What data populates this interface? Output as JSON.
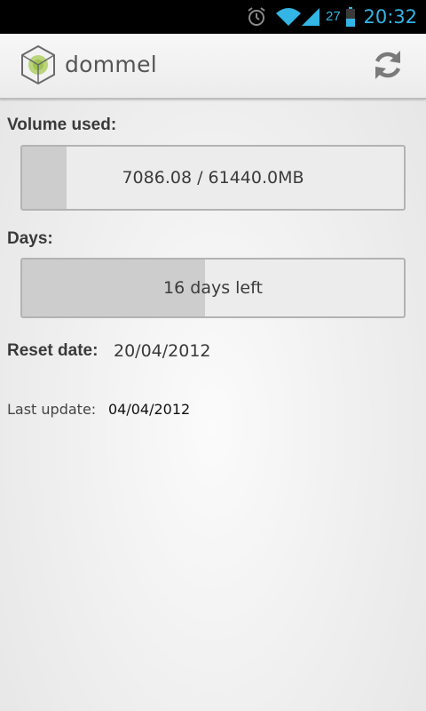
{
  "status_bar": {
    "time": "20:32",
    "battery_level": "27",
    "icons": [
      "alarm-icon",
      "wifi-icon",
      "signal-icon",
      "battery-icon"
    ],
    "accent_color": "#33b5e5"
  },
  "app_bar": {
    "title": "dommel",
    "logo_icon": "dommel-logo-icon",
    "refresh_icon": "refresh-icon"
  },
  "volume": {
    "label": "Volume used:",
    "text": "7086.08 / 61440.0MB",
    "used": 7086.08,
    "total": 61440.0,
    "unit": "MB"
  },
  "days": {
    "label": "Days:",
    "text": "16 days left",
    "progress_fraction": 0.48
  },
  "reset": {
    "label": "Reset date:",
    "value": "20/04/2012"
  },
  "last_update": {
    "label": "Last update:",
    "value": "04/04/2012"
  }
}
